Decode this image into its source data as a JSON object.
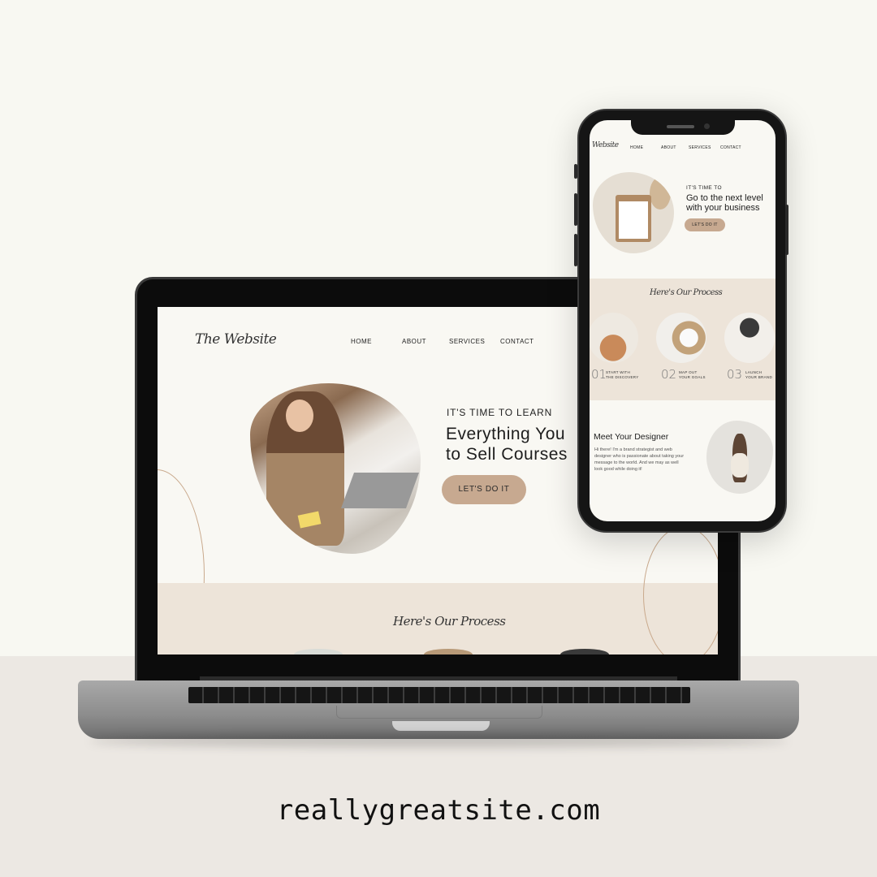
{
  "laptop_site": {
    "logo": "The Website",
    "nav": [
      "HOME",
      "ABOUT",
      "SERVICES",
      "CONTACT"
    ],
    "hero": {
      "kicker": "IT'S TIME TO LEARN",
      "headline_line1": "Everything You",
      "headline_line2": "to Sell Courses",
      "button": "LET'S DO IT"
    },
    "process_title": "Here's Our Process"
  },
  "phone_site": {
    "logo": "Website",
    "nav": [
      "HOME",
      "ABOUT",
      "SERVICES",
      "CONTACT"
    ],
    "hero": {
      "kicker": "IT'S TIME TO",
      "headline_line1": "Go to the next level",
      "headline_line2": "with your business",
      "button": "LET'S DO IT"
    },
    "process_title": "Here's Our Process",
    "steps": [
      {
        "num": "01",
        "line1": "START WITH",
        "line2": "THE DISCOVERY"
      },
      {
        "num": "02",
        "line1": "MAP OUT",
        "line2": "YOUR GOALS"
      },
      {
        "num": "03",
        "line1": "LAUNCH",
        "line2": "YOUR BRAND"
      }
    ],
    "designer": {
      "title": "Meet Your Designer",
      "body": "Hi there! I'm a brand strategist and web designer who is passionate about taking your message to the world. And we may as well look good while doing it!"
    }
  },
  "footer_url": "reallygreatsite.com",
  "colors": {
    "accent": "#c7a990",
    "band": "#ede4d9",
    "page": "#f9f8f3"
  }
}
